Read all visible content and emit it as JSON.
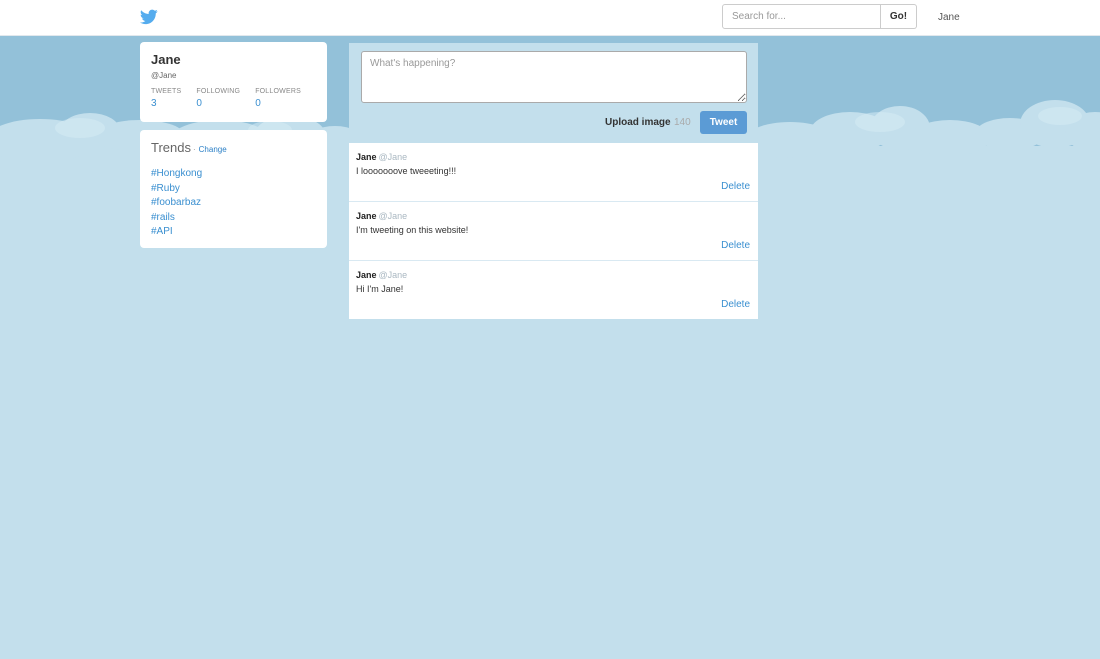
{
  "nav": {
    "logo_icon": "twitter-bird-icon",
    "search_placeholder": "Search for...",
    "go_label": "Go!",
    "user": "Jane"
  },
  "profile": {
    "name": "Jane",
    "handle": "@Jane",
    "stats": [
      {
        "label": "TWEETS",
        "value": "3"
      },
      {
        "label": "FOLLOWING",
        "value": "0"
      },
      {
        "label": "FOLLOWERS",
        "value": "0"
      }
    ]
  },
  "trends": {
    "title": "Trends",
    "separator": "·",
    "change_label": "Change",
    "items": [
      "#Hongkong",
      "#Ruby",
      "#foobarbaz",
      "#rails",
      "#API"
    ]
  },
  "composer": {
    "placeholder": "What's happening?",
    "upload_label": "Upload image",
    "char_count": "140",
    "tweet_label": "Tweet"
  },
  "tweets": [
    {
      "name": "Jane",
      "handle": "@Jane",
      "text": "I looooooove tweeeting!!!",
      "delete_label": "Delete"
    },
    {
      "name": "Jane",
      "handle": "@Jane",
      "text": "I'm tweeting on this website!",
      "delete_label": "Delete"
    },
    {
      "name": "Jane",
      "handle": "@Jane",
      "text": "Hi I'm Jane!",
      "delete_label": "Delete"
    }
  ],
  "colors": {
    "accent": "#3a8fd0",
    "tweet_button": "#5b9bd5",
    "page_background": "#c3dfec",
    "sky": "#93c1d9"
  }
}
